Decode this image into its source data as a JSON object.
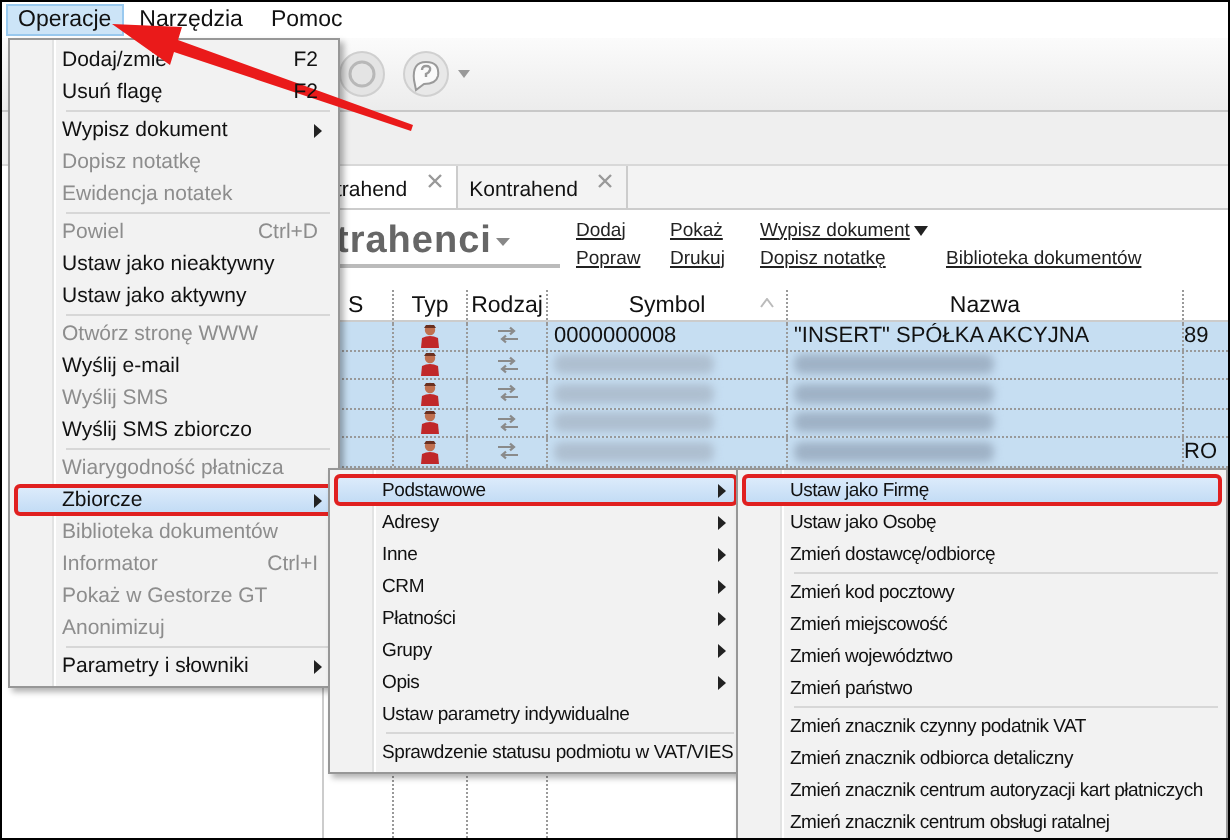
{
  "menubar": [
    {
      "label": "Operacje",
      "selected": true
    },
    {
      "label": "Narzędzia",
      "selected": false
    },
    {
      "label": "Pomoc",
      "selected": false
    }
  ],
  "tabs": [
    {
      "label": "trahend",
      "selected": true
    },
    {
      "label": "Kontrahend",
      "selected": false
    }
  ],
  "title": "trahenci",
  "link_rows": [
    [
      {
        "label": "Dodaj",
        "dropdown": false
      },
      {
        "label": "Pokaż",
        "dropdown": false
      },
      {
        "label": "Wypisz dokument",
        "dropdown": true
      }
    ],
    [
      {
        "label": "Popraw",
        "dropdown": false
      },
      {
        "label": "Drukuj",
        "dropdown": false
      },
      {
        "label": "Dopisz notatkę",
        "dropdown": false
      },
      {
        "label": "Biblioteka dokumentów",
        "dropdown": false
      }
    ]
  ],
  "table": {
    "columns": [
      {
        "label": "S",
        "sorted": false
      },
      {
        "label": "Typ",
        "sorted": false
      },
      {
        "label": "Rodzaj",
        "sorted": false
      },
      {
        "label": "Symbol",
        "sorted": true
      },
      {
        "label": "Nazwa",
        "sorted": false
      },
      {
        "sorted": false
      }
    ],
    "rows": [
      {
        "selected": true,
        "redacted": false,
        "symbol": "0000000008",
        "nazwa": "\"INSERT\" SPÓŁKA AKCYJNA",
        "column_6": "89"
      },
      {
        "selected": true,
        "redacted": true
      },
      {
        "selected": true,
        "redacted": true
      },
      {
        "selected": true,
        "redacted": true
      },
      {
        "selected": true,
        "redacted": true,
        "column_6": "RO"
      }
    ]
  },
  "menus": [
    {
      "groups": [
        [
          {
            "label": "Dodaj/zmie",
            "shortcut": "F2",
            "disabled": false,
            "submenu": false,
            "selected": false
          },
          {
            "label": "Usuń flagę",
            "shortcut": "F2",
            "disabled": false,
            "submenu": false,
            "selected": false
          }
        ],
        [
          {
            "label": "Wypisz dokument",
            "disabled": false,
            "submenu": true,
            "selected": false
          },
          {
            "label": "Dopisz notatkę",
            "disabled": true,
            "submenu": false,
            "selected": false
          },
          {
            "label": "Ewidencja notatek",
            "disabled": true,
            "submenu": false,
            "selected": false
          }
        ],
        [
          {
            "label": "Powiel",
            "shortcut": "Ctrl+D",
            "disabled": true,
            "submenu": false,
            "selected": false
          },
          {
            "label": "Ustaw jako nieaktywny",
            "disabled": false,
            "submenu": false,
            "selected": false
          },
          {
            "label": "Ustaw jako aktywny",
            "disabled": false,
            "submenu": false,
            "selected": false
          }
        ],
        [
          {
            "label": "Otwórz stronę WWW",
            "disabled": true,
            "submenu": false,
            "selected": false
          },
          {
            "label": "Wyślij e-mail",
            "disabled": false,
            "submenu": false,
            "selected": false
          },
          {
            "label": "Wyślij SMS",
            "disabled": true,
            "submenu": false,
            "selected": false
          },
          {
            "label": "Wyślij SMS zbiorczo",
            "disabled": false,
            "submenu": false,
            "selected": false
          }
        ],
        [
          {
            "label": "Wiarygodność płatnicza",
            "disabled": true,
            "submenu": false,
            "selected": false
          },
          {
            "label": "Zbiorcze",
            "disabled": false,
            "submenu": true,
            "selected": true
          },
          {
            "label": "Biblioteka dokumentów",
            "disabled": true,
            "submenu": false,
            "selected": false
          },
          {
            "label": "Informator",
            "shortcut": "Ctrl+I",
            "disabled": true,
            "submenu": false,
            "selected": false
          },
          {
            "label": "Pokaż w Gestorze GT",
            "disabled": true,
            "submenu": false,
            "selected": false
          },
          {
            "label": "Anonimizuj",
            "disabled": true,
            "submenu": false,
            "selected": false
          }
        ],
        [
          {
            "label": "Parametry i słowniki",
            "disabled": false,
            "submenu": true,
            "selected": false
          }
        ]
      ]
    },
    {
      "groups": [
        [
          {
            "label": "Podstawowe",
            "disabled": false,
            "submenu": true,
            "selected": true
          },
          {
            "label": "Adresy",
            "disabled": false,
            "submenu": true,
            "selected": false
          },
          {
            "label": "Inne",
            "disabled": false,
            "submenu": true,
            "selected": false
          },
          {
            "label": "CRM",
            "disabled": false,
            "submenu": true,
            "selected": false
          },
          {
            "label": "Płatności",
            "disabled": false,
            "submenu": true,
            "selected": false
          },
          {
            "label": "Grupy",
            "disabled": false,
            "submenu": true,
            "selected": false
          },
          {
            "label": "Opis",
            "disabled": false,
            "submenu": true,
            "selected": false
          },
          {
            "label": "Ustaw parametry indywidualne",
            "disabled": false,
            "submenu": false,
            "selected": false
          }
        ],
        [
          {
            "label": "Sprawdzenie statusu podmiotu w VAT/VIES",
            "disabled": false,
            "submenu": false,
            "selected": false
          }
        ]
      ]
    },
    {
      "groups": [
        [
          {
            "label": "Ustaw jako Firmę",
            "disabled": false,
            "submenu": false,
            "selected": true
          },
          {
            "label": "Ustaw jako Osobę",
            "disabled": false,
            "submenu": false,
            "selected": false
          },
          {
            "label": "Zmień dostawcę/odbiorcę",
            "disabled": false,
            "submenu": false,
            "selected": false
          }
        ],
        [
          {
            "label": "Zmień kod pocztowy",
            "disabled": false,
            "submenu": false,
            "selected": false
          },
          {
            "label": "Zmień miejscowość",
            "disabled": false,
            "submenu": false,
            "selected": false
          },
          {
            "label": "Zmień województwo",
            "disabled": false,
            "submenu": false,
            "selected": false
          },
          {
            "label": "Zmień państwo",
            "disabled": false,
            "submenu": false,
            "selected": false
          }
        ],
        [
          {
            "label": "Zmień znacznik czynny podatnik VAT",
            "disabled": false,
            "submenu": false,
            "selected": false
          },
          {
            "label": "Zmień znacznik odbiorca detaliczny",
            "disabled": false,
            "submenu": false,
            "selected": false
          },
          {
            "label": "Zmień znacznik centrum autoryzacji kart płatniczych",
            "disabled": false,
            "submenu": false,
            "selected": false
          },
          {
            "label": "Zmień znacznik centrum obsługi ratalnej",
            "disabled": false,
            "submenu": false,
            "selected": false
          }
        ]
      ]
    }
  ]
}
